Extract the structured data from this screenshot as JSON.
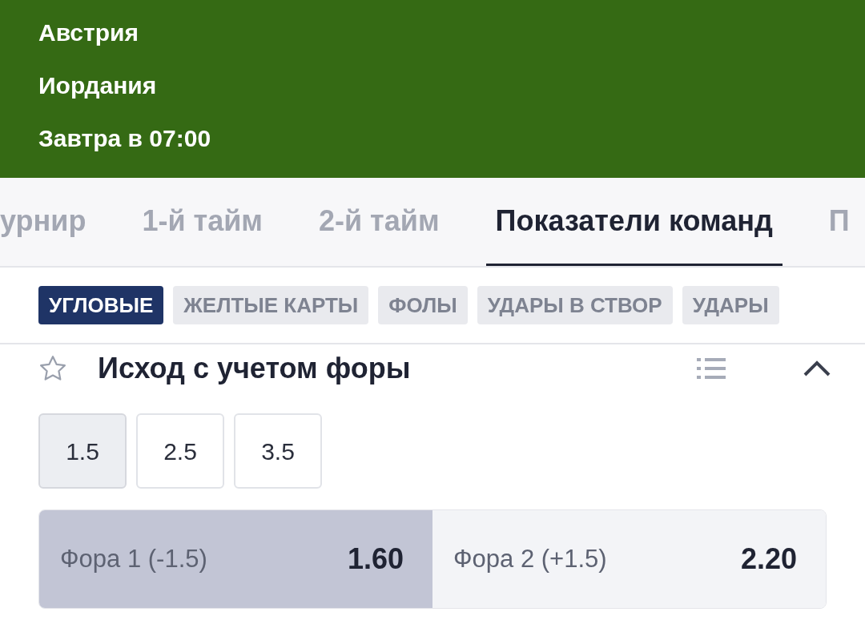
{
  "header": {
    "team_1": "Австрия",
    "team_2": "Иордания",
    "time": "Завтра в 07:00"
  },
  "tabs": [
    {
      "label": "урнир",
      "selected": false
    },
    {
      "label": "1-й тайм",
      "selected": false
    },
    {
      "label": "2-й тайм",
      "selected": false
    },
    {
      "label": "Показатели команд",
      "selected": true
    },
    {
      "label": "П",
      "selected": false
    }
  ],
  "chips": [
    {
      "label": "УГЛОВЫЕ",
      "selected": true
    },
    {
      "label": "ЖЕЛТЫЕ КАРТЫ",
      "selected": false
    },
    {
      "label": "ФОЛЫ",
      "selected": false
    },
    {
      "label": "УДАРЫ В СТВОР",
      "selected": false
    },
    {
      "label": "УДАРЫ",
      "selected": false
    }
  ],
  "market": {
    "title": "Исход с учетом форы",
    "favorite": false,
    "expanded": true,
    "lines": [
      {
        "label": "1.5",
        "selected": true
      },
      {
        "label": "2.5",
        "selected": false
      },
      {
        "label": "3.5",
        "selected": false
      }
    ],
    "outcomes": [
      {
        "label": "Фора 1 (-1.5)",
        "odds": "1.60",
        "selected": true
      },
      {
        "label": "Фора 2 (+1.5)",
        "odds": "2.20",
        "selected": false
      }
    ]
  }
}
